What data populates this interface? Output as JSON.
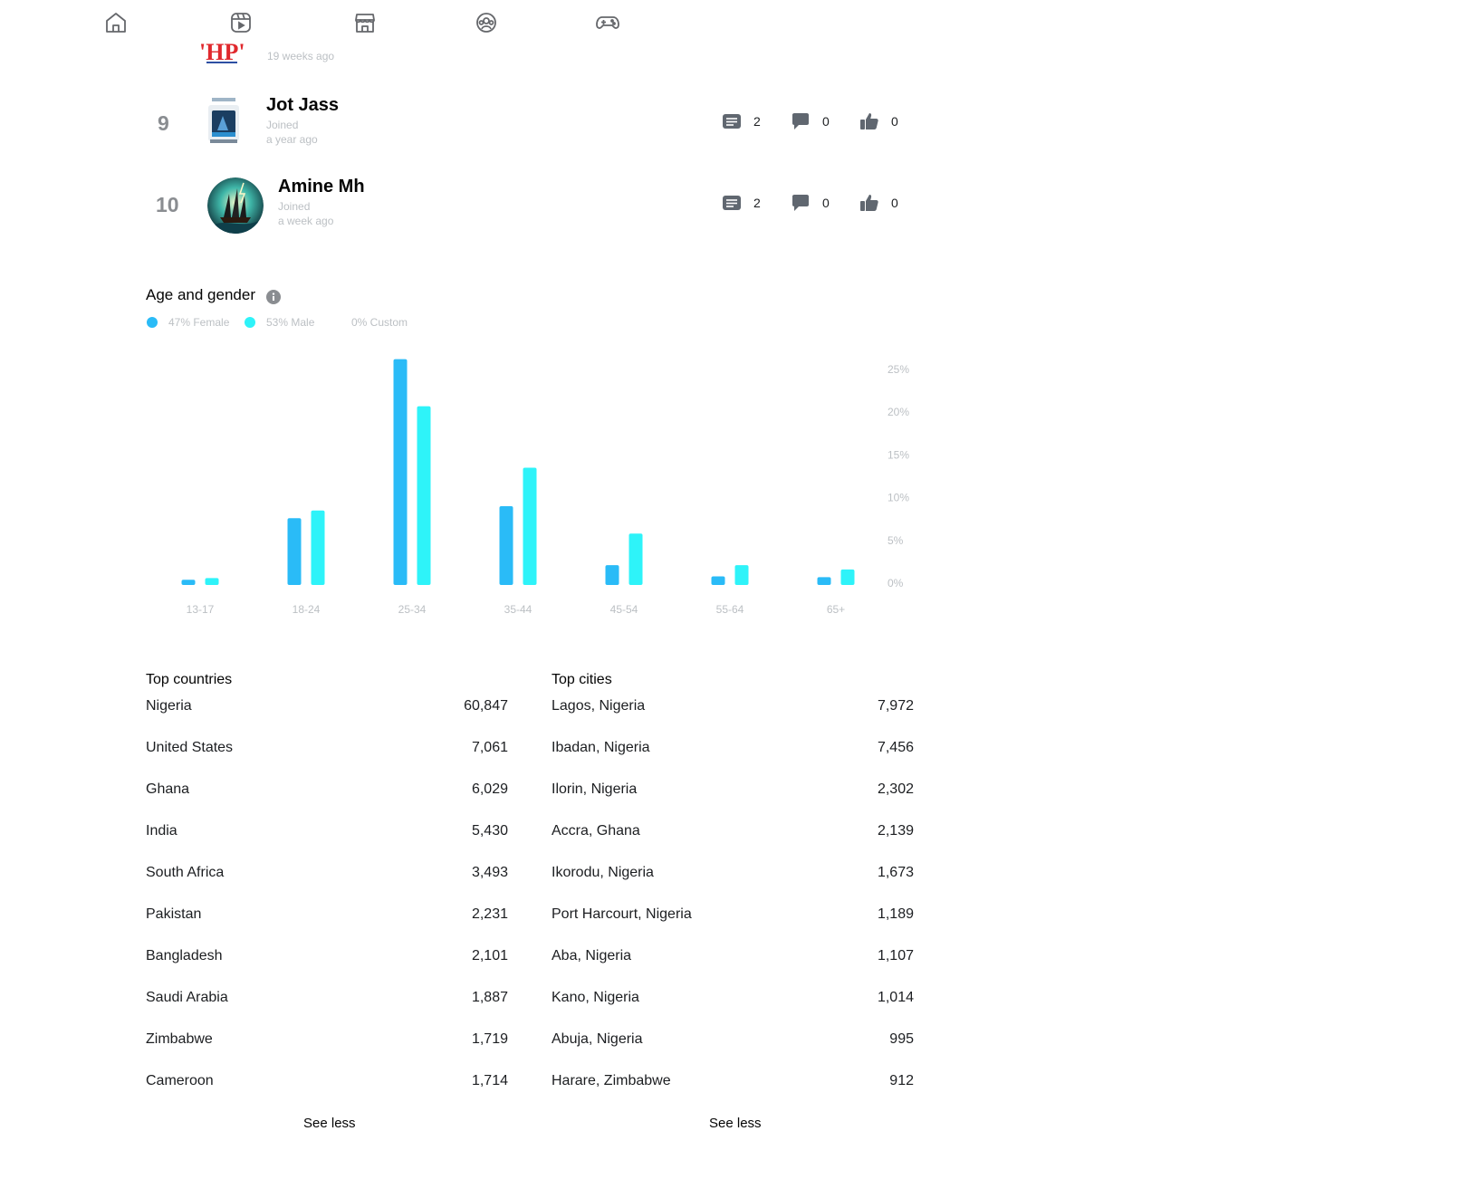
{
  "nav": {
    "icons": [
      "home-icon",
      "video-icon",
      "marketplace-icon",
      "groups-icon",
      "gaming-icon"
    ]
  },
  "partial_row": {
    "joined_line2": "19 weeks ago"
  },
  "contributors": [
    {
      "rank": "9",
      "name": "Jot Jass",
      "joined_label": "Joined",
      "joined_ago": "a year ago",
      "posts": "2",
      "comments": "0",
      "reactions": "0"
    },
    {
      "rank": "10",
      "name": "Amine Mh",
      "joined_label": "Joined",
      "joined_ago": "a week ago",
      "posts": "2",
      "comments": "0",
      "reactions": "0"
    }
  ],
  "age_gender": {
    "title": "Age and gender",
    "legend": [
      {
        "label": "47% Female",
        "color": "#2abbf7"
      },
      {
        "label": "53% Male",
        "color": "#2ef3f9"
      },
      {
        "label": "0% Custom",
        "color": ""
      }
    ]
  },
  "chart_data": {
    "type": "bar",
    "categories": [
      "13-17",
      "18-24",
      "25-34",
      "35-44",
      "45-54",
      "55-64",
      "65+"
    ],
    "series": [
      {
        "name": "Female",
        "color": "#2abbf7",
        "values": [
          0.4,
          7.6,
          26.2,
          9.0,
          2.1,
          0.8,
          0.7
        ]
      },
      {
        "name": "Male",
        "color": "#2ef3f9",
        "values": [
          0.6,
          8.5,
          20.7,
          13.5,
          5.8,
          2.1,
          1.6
        ]
      }
    ],
    "y_ticks": [
      "25%",
      "20%",
      "15%",
      "10%",
      "5%",
      "0%"
    ],
    "ylim": [
      0,
      25
    ],
    "grid": false,
    "legend": "top-left"
  },
  "top_countries": {
    "title": "Top countries",
    "rows": [
      {
        "name": "Nigeria",
        "count": "60,847"
      },
      {
        "name": "United States",
        "count": "7,061"
      },
      {
        "name": "Ghana",
        "count": "6,029"
      },
      {
        "name": "India",
        "count": "5,430"
      },
      {
        "name": "South Africa",
        "count": "3,493"
      },
      {
        "name": "Pakistan",
        "count": "2,231"
      },
      {
        "name": "Bangladesh",
        "count": "2,101"
      },
      {
        "name": "Saudi Arabia",
        "count": "1,887"
      },
      {
        "name": "Zimbabwe",
        "count": "1,719"
      },
      {
        "name": "Cameroon",
        "count": "1,714"
      }
    ],
    "see_less": "See less"
  },
  "top_cities": {
    "title": "Top cities",
    "rows": [
      {
        "name": "Lagos, Nigeria",
        "count": "7,972"
      },
      {
        "name": "Ibadan, Nigeria",
        "count": "7,456"
      },
      {
        "name": "Ilorin, Nigeria",
        "count": "2,302"
      },
      {
        "name": "Accra, Ghana",
        "count": "2,139"
      },
      {
        "name": "Ikorodu, Nigeria",
        "count": "1,673"
      },
      {
        "name": "Port Harcourt, Nigeria",
        "count": "1,189"
      },
      {
        "name": "Aba, Nigeria",
        "count": "1,107"
      },
      {
        "name": "Kano, Nigeria",
        "count": "1,014"
      },
      {
        "name": "Abuja, Nigeria",
        "count": "995"
      },
      {
        "name": "Harare, Zimbabwe",
        "count": "912"
      }
    ],
    "see_less": "See less"
  }
}
